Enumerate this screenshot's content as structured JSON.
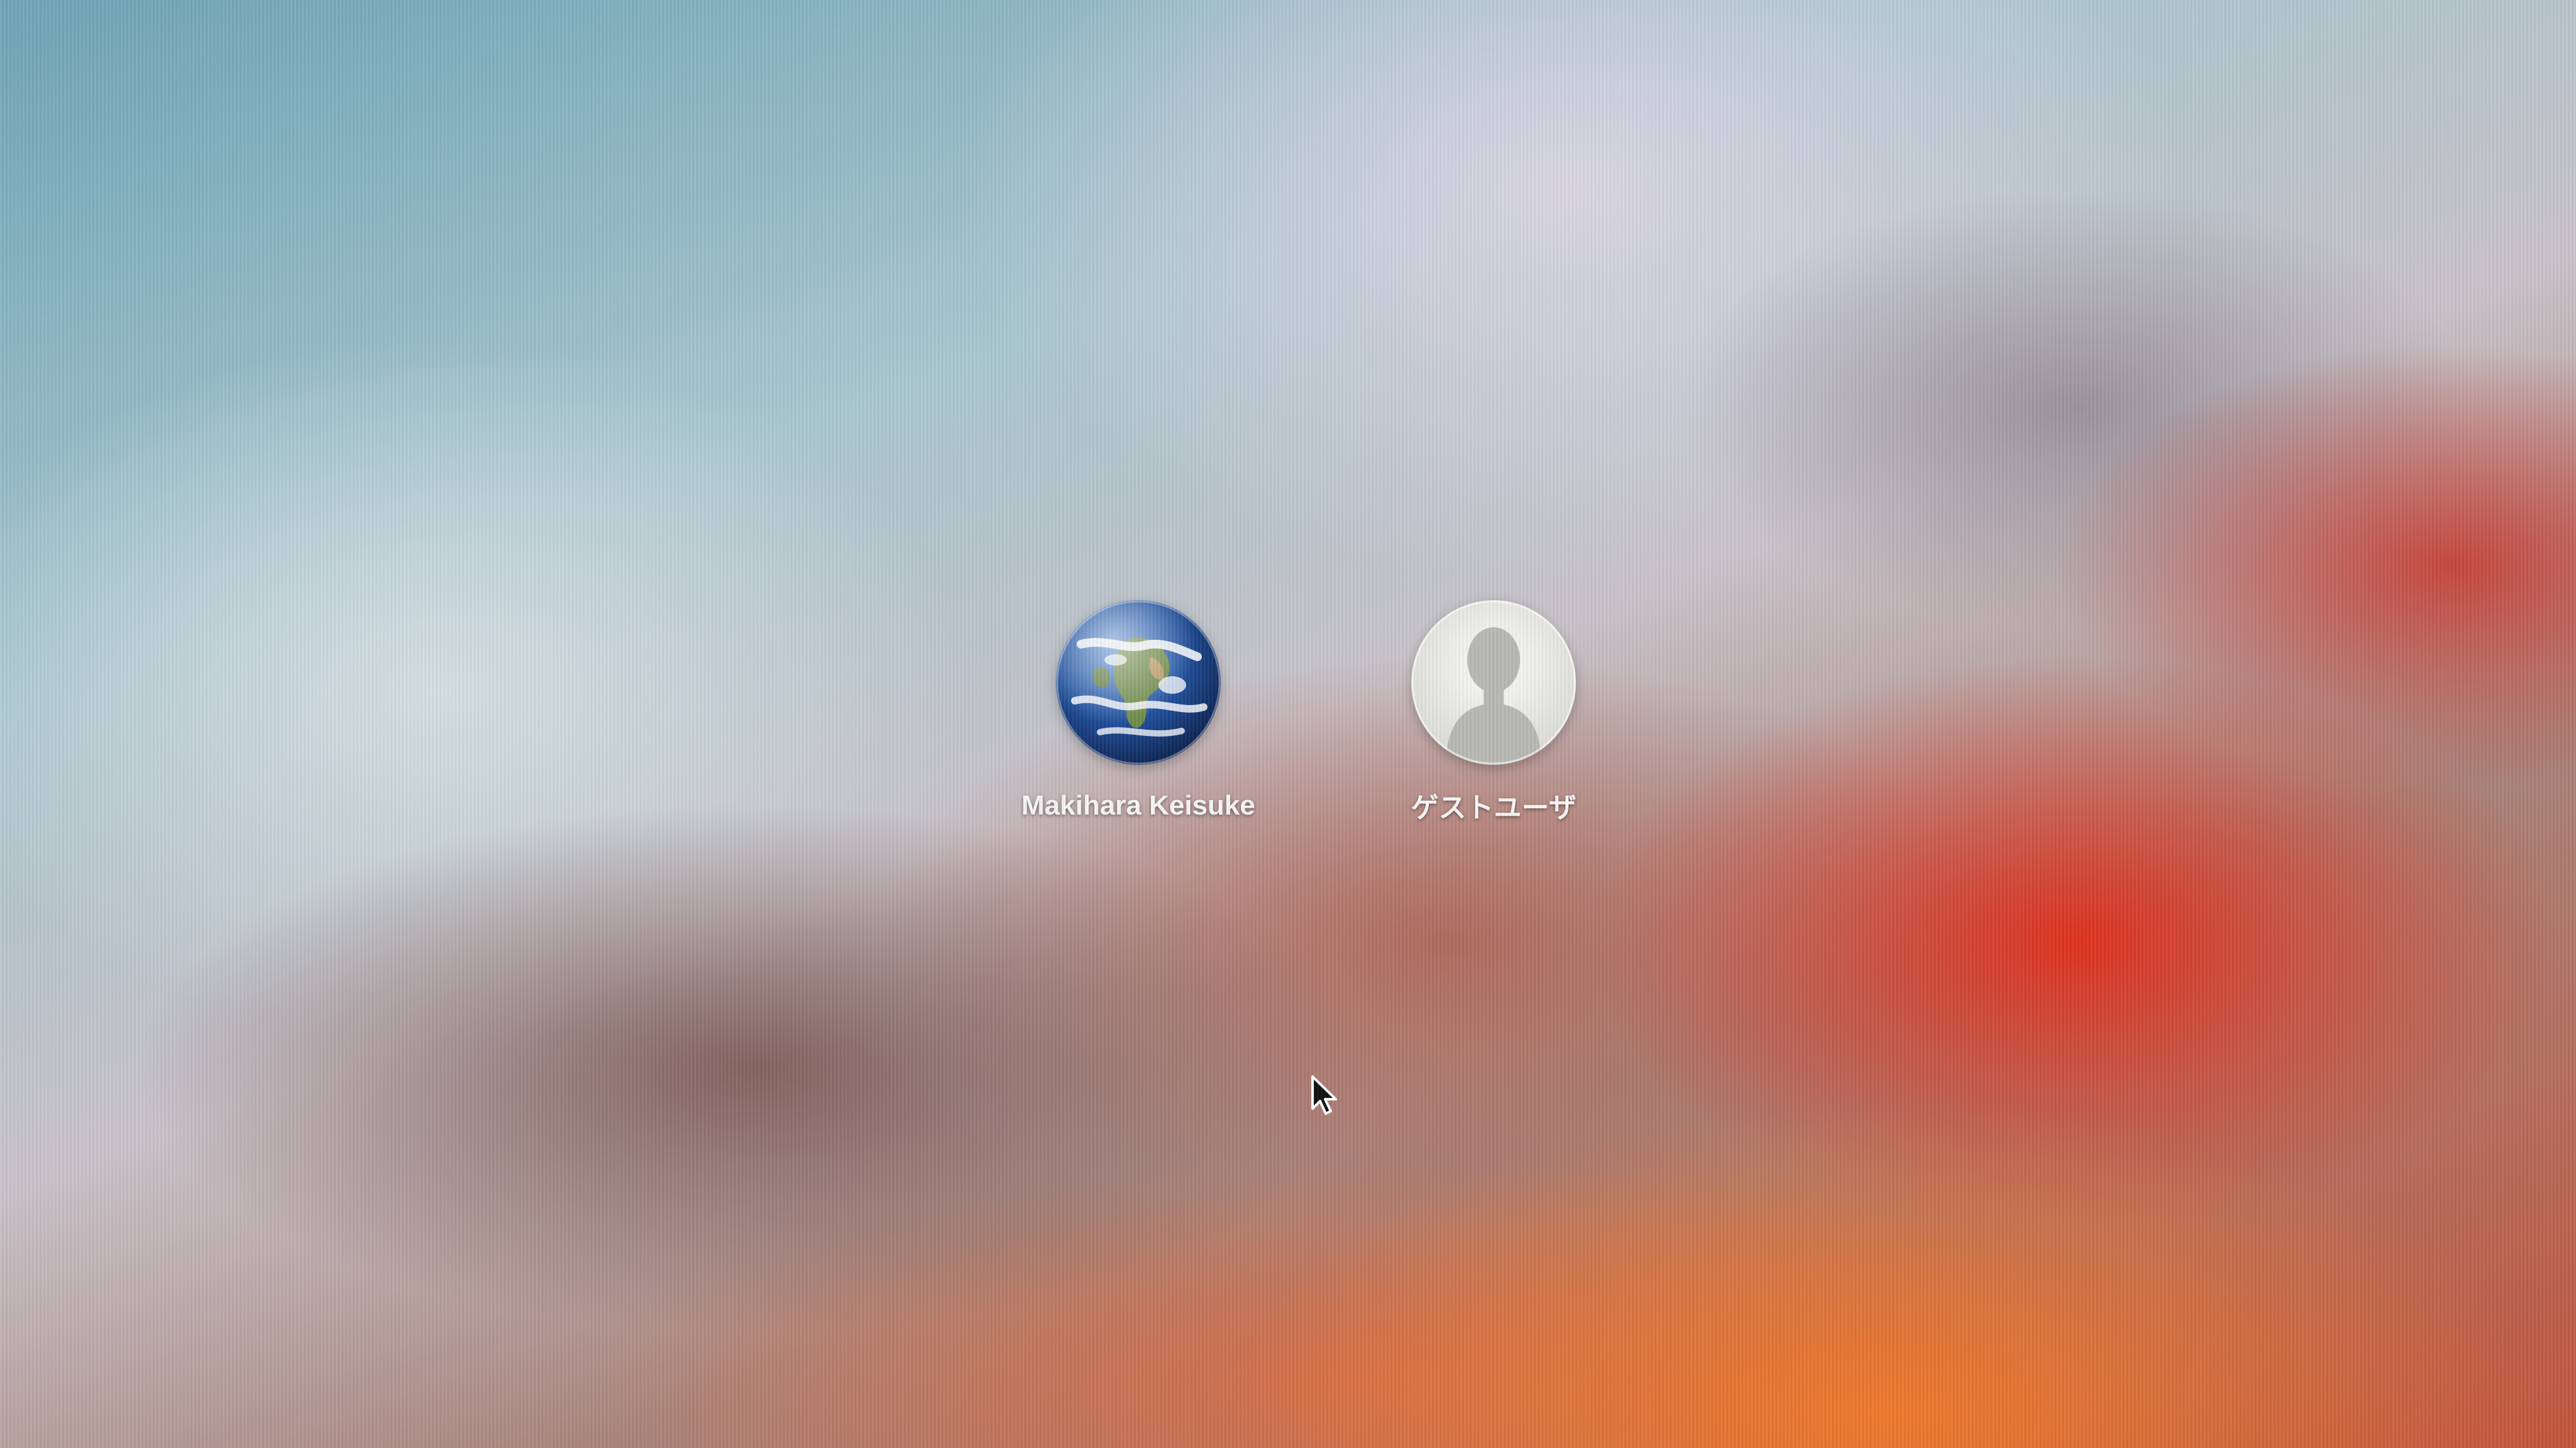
{
  "login_screen": {
    "users": [
      {
        "name": "Makihara Keisuke",
        "avatar": "earth-globe-icon"
      },
      {
        "name": "ゲストユーザ",
        "avatar": "guest-silhouette-icon"
      }
    ]
  },
  "colors": {
    "label_text": "#f5f5f5",
    "wallpaper_sky": "#a9c6cf",
    "wallpaper_mountain": "#c2543c"
  },
  "cursor": {
    "icon": "arrow-pointer-icon"
  }
}
